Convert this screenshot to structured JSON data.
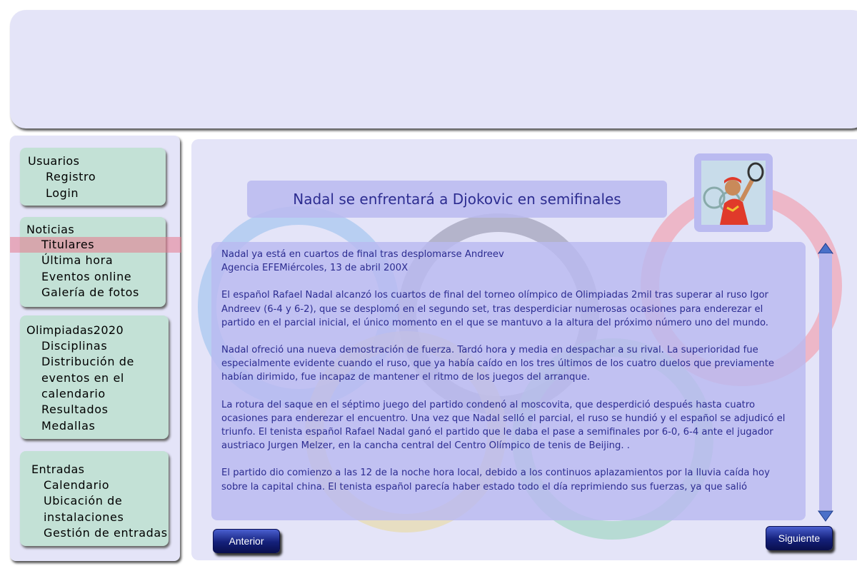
{
  "sidebar": {
    "users": {
      "title": "Usuarios",
      "items": [
        "Registro",
        "Login"
      ]
    },
    "news": {
      "title": "Noticias",
      "items": [
        "Titulares",
        "Última hora",
        "Eventos online",
        "Galería de fotos"
      ]
    },
    "olympics": {
      "title": "Olimpiadas2020",
      "items": [
        "Disciplinas",
        "Distribución de",
        "eventos en el",
        "calendario",
        "Resultados",
        "Medallas"
      ]
    },
    "tickets": {
      "title": "Entradas",
      "items": [
        "Calendario",
        "Ubicación de",
        "instalaciones",
        "Gestión de entradas"
      ]
    },
    "active_item": "Titulares"
  },
  "article": {
    "headline": "Nadal se enfrentará a Djokovic en semifinales",
    "paragraphs": [
      "Nadal ya está en cuartos de final tras desplomarse Andreev\nAgencia EFEMiércoles, 13 de abril 200X",
      "El español Rafael Nadal alcanzó los cuartos de final del torneo olímpico de Olimpiadas 2mil tras superar al ruso Igor Andreev (6-4 y 6-2), que se desplomó en el segundo set, tras desperdiciar numerosas ocasiones para enderezar el partido en el parcial inicial, el único momento en el que se mantuvo a la altura del próximo número uno del mundo.",
      "Nadal ofreció una nueva demostración de fuerza. Tardó hora y media en despachar a su rival. La superioridad fue especialmente evidente cuando el ruso, que ya había caído en los tres últimos de los cuatro duelos que previamente habían dirimido, fue incapaz de mantener el ritmo de los juegos del arranque.",
      "La rotura del saque en el séptimo juego del partido condenó al moscovita, que desperdició después hasta cuatro ocasiones para enderezar el encuentro. Una vez que Nadal selló el parcial, el ruso se hundió y el español se adjudicó el triunfo. El tenista español Rafael Nadal ganó el partido que le daba el pase a semifinales por 6-0, 6-4 ante el jugador austriaco Jurgen Melzer, en la cancha central del Centro Olímpico de tenis de Beijing. .",
      "El partido dio comienzo a las 12 de la noche hora local, debido a los continuos aplazamientos por la lluvia caída hoy sobre la capital china. El tenista español parecía haber estado todo el día reprimiendo sus fuerzas, ya que salió"
    ]
  },
  "nav": {
    "prev_label": "Anterior",
    "next_label": "Siguiente"
  },
  "colors": {
    "panel_bg": "#e4e4f8",
    "menu_bg": "#c3e1d6",
    "text_blue": "#2c2c90",
    "highlight": "#e6788c",
    "button_dark": "#14207a",
    "ring_blue": "#aac8f0",
    "ring_dark": "#9a9ab0",
    "ring_red": "#f0a8b8",
    "ring_yellow": "#e8dcb0",
    "ring_green": "#a8d8c8"
  }
}
